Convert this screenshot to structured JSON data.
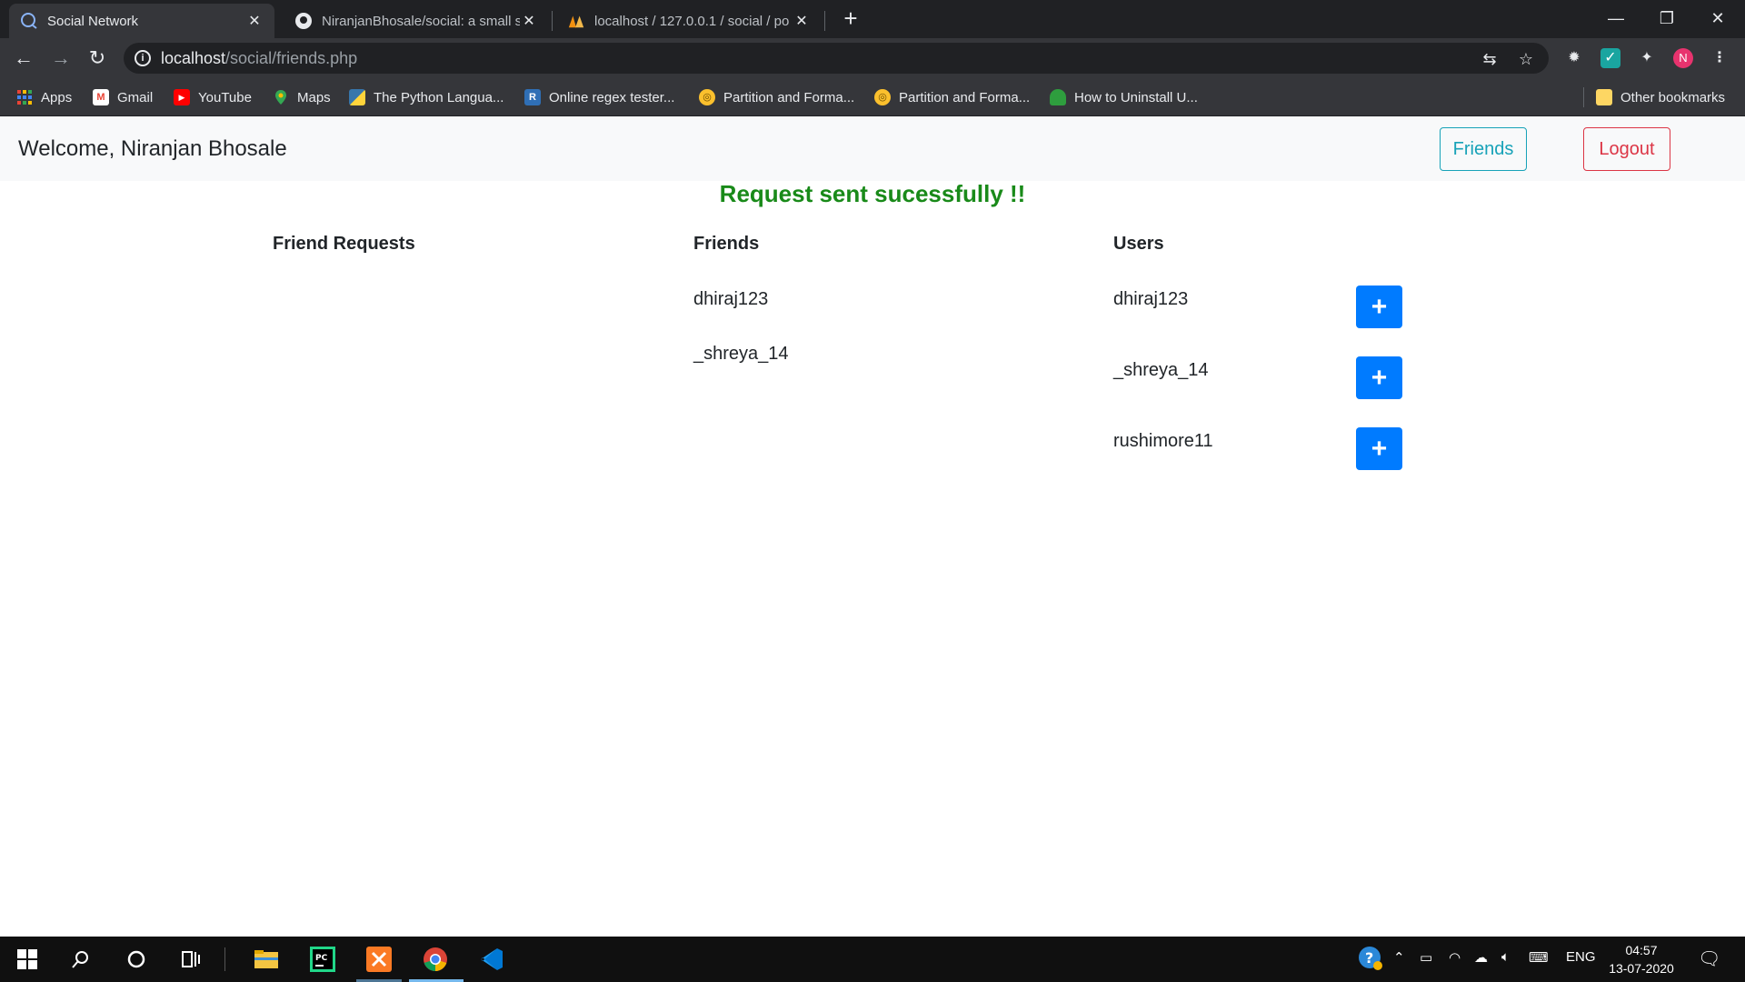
{
  "browser": {
    "tabs": [
      {
        "title": "Social Network",
        "active": true
      },
      {
        "title": "NiranjanBhosale/social: a small so",
        "active": false
      },
      {
        "title": "localhost / 127.0.0.1 / social / po",
        "active": false
      }
    ],
    "url_host": "localhost",
    "url_path": "/social/friends.php",
    "profile_initial": "N",
    "bookmarks": [
      "Apps",
      "Gmail",
      "YouTube",
      "Maps",
      "The Python Langua...",
      "Online regex tester...",
      "Partition and Forma...",
      "Partition and Forma...",
      "How to Uninstall U..."
    ],
    "other_bookmarks": "Other bookmarks"
  },
  "navbar": {
    "welcome": "Welcome, Niranjan Bhosale",
    "friends_label": "Friends",
    "logout_label": "Logout"
  },
  "alert": "Request sent sucessfully !!",
  "columns": {
    "requests_title": "Friend Requests",
    "friends_title": "Friends",
    "users_title": "Users"
  },
  "friends": [
    "dhiraj123",
    "_shreya_14"
  ],
  "users": [
    "dhiraj123",
    "_shreya_14",
    "rushimore11"
  ],
  "add_label": "+",
  "taskbar": {
    "lang": "ENG",
    "time": "04:57",
    "date": "13-07-2020"
  },
  "colors": {
    "primary": "#007bff",
    "info": "#17a2b8",
    "danger": "#dc3545",
    "success_text": "#198a19"
  }
}
